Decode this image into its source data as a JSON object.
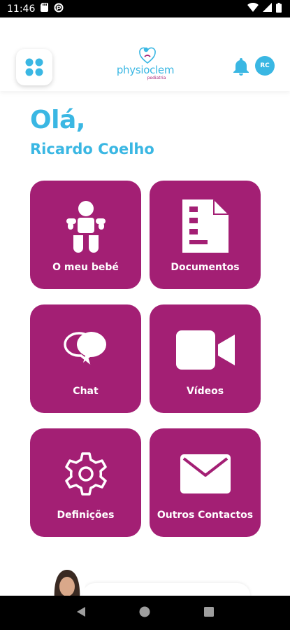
{
  "status_bar": {
    "time": "11:46"
  },
  "header": {
    "logo_text": "physioclem",
    "logo_sub": "pediatria",
    "user_initials": "RC"
  },
  "greeting": "Olá,",
  "user_name": "Ricardo Coelho",
  "tiles": [
    {
      "label": "O meu bebé",
      "icon": "baby-icon"
    },
    {
      "label": "Documentos",
      "icon": "document-icon"
    },
    {
      "label": "Chat",
      "icon": "chat-icon"
    },
    {
      "label": "Vídeos",
      "icon": "video-camera-icon"
    },
    {
      "label": "Definições",
      "icon": "gear-icon"
    },
    {
      "label": "Outros Contactos",
      "icon": "mail-icon"
    }
  ],
  "colors": {
    "accent": "#3ab7e3",
    "tile": "#a31f74"
  }
}
